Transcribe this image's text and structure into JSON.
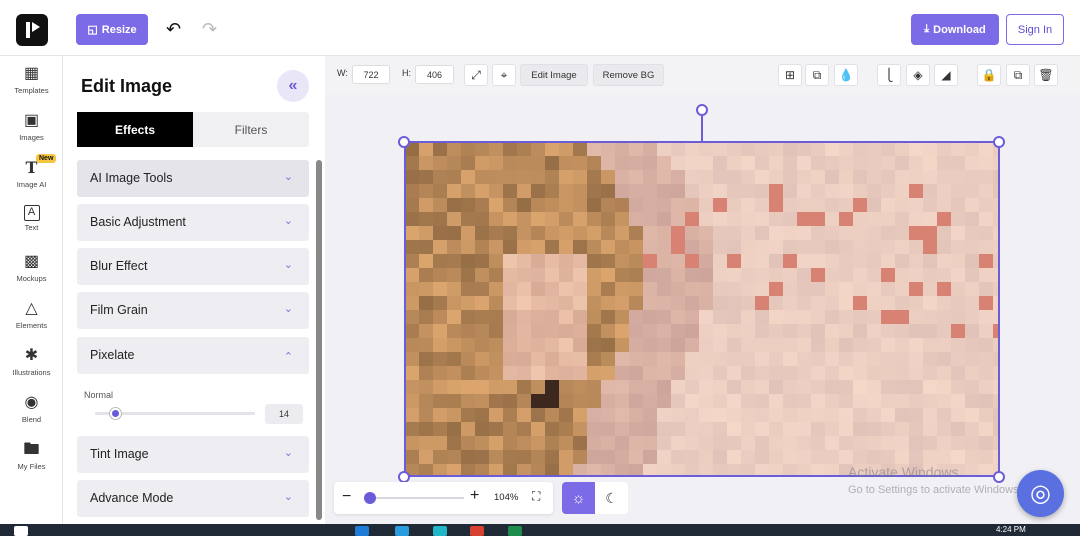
{
  "header": {
    "resize_label": "Resize",
    "download_label": "Download",
    "signin_label": "Sign In",
    "icons": [
      "logo-icon",
      "resize-icon",
      "undo-icon",
      "redo-icon",
      "download-icon"
    ]
  },
  "sidebar": {
    "items": [
      {
        "label": "Templates",
        "icon": "templates-icon"
      },
      {
        "label": "Images",
        "icon": "image-icon"
      },
      {
        "label": "Image AI",
        "icon": "text-ai-icon",
        "badge": "New"
      },
      {
        "label": "Text",
        "icon": "text-icon"
      },
      {
        "label": "Mockups",
        "icon": "mockup-icon"
      },
      {
        "label": "Elements",
        "icon": "elements-icon"
      },
      {
        "label": "Illustrations",
        "icon": "illustration-icon"
      },
      {
        "label": "Blend",
        "icon": "palette-icon"
      },
      {
        "label": "My Files",
        "icon": "folder-icon"
      }
    ]
  },
  "panel": {
    "title": "Edit Image",
    "tabs": [
      {
        "label": "Effects",
        "active": true
      },
      {
        "label": "Filters",
        "active": false
      }
    ],
    "sections": [
      {
        "label": "AI Image Tools",
        "expanded": false
      },
      {
        "label": "Basic Adjustment",
        "expanded": false
      },
      {
        "label": "Blur Effect",
        "expanded": false
      },
      {
        "label": "Film Grain",
        "expanded": false
      },
      {
        "label": "Pixelate",
        "expanded": true
      },
      {
        "label": "Tint Image",
        "expanded": false
      },
      {
        "label": "Advance Mode",
        "expanded": false
      }
    ],
    "pixelate": {
      "mode_label": "Normal",
      "value": "14",
      "fraction": 0.1
    }
  },
  "toolbar": {
    "width_label": "W:",
    "width_value": "722",
    "height_label": "H:",
    "height_value": "406",
    "edit_image_label": "Edit Image",
    "remove_bg_label": "Remove BG",
    "icons": [
      "expand-icon",
      "crop-icon",
      "grid-icon",
      "layer-copy-icon",
      "opacity-icon",
      "align-icon",
      "layers-icon",
      "flip-icon",
      "lock-icon",
      "duplicate-icon",
      "trash-icon"
    ]
  },
  "zoom": {
    "value_label": "104%",
    "fraction": 0.0
  },
  "watermark": {
    "line1": "Activate Windows",
    "line2": "Go to Settings to activate Windows."
  },
  "taskbar": {
    "time": "4:24 PM"
  },
  "colors": {
    "accent": "#7b6be6",
    "selection": "#6b5dd8"
  }
}
